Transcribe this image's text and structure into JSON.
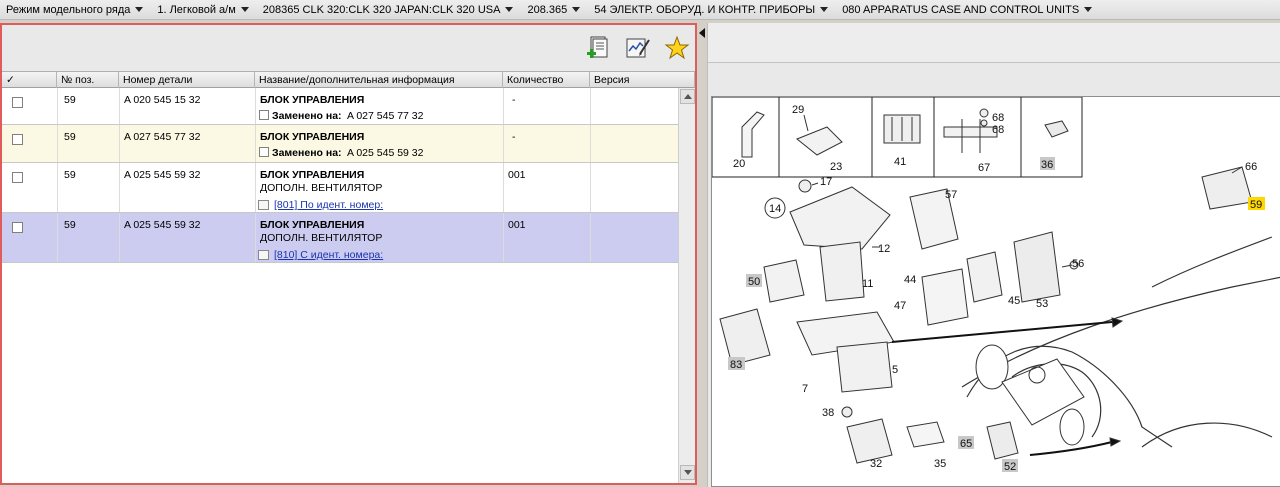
{
  "breadcrumbs": [
    {
      "label": "Режим модельного ряда"
    },
    {
      "label": "1. Легковой а/м"
    },
    {
      "label": "208365 CLK 320:CLK 320 JAPAN:CLK 320 USA"
    },
    {
      "label": "208.365"
    },
    {
      "label": "54 ЭЛЕКТР. ОБОРУД. И КОНТР. ПРИБОРЫ"
    },
    {
      "label": "080 APPARATUS CASE AND CONTROL UNITS"
    }
  ],
  "toolbar": {
    "icons": [
      "add-to-cart-icon",
      "notes-edit-icon",
      "favorite-star-icon"
    ]
  },
  "grid": {
    "columns": {
      "check": "✓",
      "pos": "№ поз.",
      "part": "Номер детали",
      "name": "Название/дополнительная информация",
      "qty": "Количество",
      "version": "Версия"
    },
    "rows": [
      {
        "pos": "59",
        "part": "A 020 545 15 32",
        "name": "БЛОК УПРАВЛЕНИЯ",
        "qty": "-",
        "replaced_label": "Заменено на:",
        "replaced_value": "A 027 545 77 32",
        "bg": "#ffffff"
      },
      {
        "pos": "59",
        "part": "A 027 545 77 32",
        "name": "БЛОК УПРАВЛЕНИЯ",
        "qty": "-",
        "replaced_label": "Заменено на:",
        "replaced_value": "A 025 545 59 32",
        "bg": "#fbf8e3"
      },
      {
        "pos": "59",
        "part": "A 025 545 59 32",
        "name": "БЛОК УПРАВЛЕНИЯ",
        "extra": "ДОПОЛН. ВЕНТИЛЯТОР",
        "qty": "001",
        "link": "[801] По идент. номер:",
        "bg": "#ffffff"
      },
      {
        "pos": "59",
        "part": "A 025 545 59 32",
        "name": "БЛОК УПРАВЛЕНИЯ",
        "extra": "ДОПОЛН. ВЕНТИЛЯТОР",
        "qty": "001",
        "link": "[810] С идент. номера:",
        "bg": "#ccccf0"
      }
    ]
  },
  "diagram": {
    "labels": {
      "l20": "20",
      "l29": "29",
      "l23": "23",
      "l41": "41",
      "l68a": "68",
      "l68b": "68",
      "l67": "67",
      "l36": "36",
      "l66": "66",
      "l59": "59",
      "l17": "17",
      "l14": "14",
      "l57": "57",
      "l12": "12",
      "l50": "50",
      "l44": "44",
      "l11": "11",
      "l56": "56",
      "l45": "45",
      "l53": "53",
      "l47": "47",
      "l83": "83",
      "l5": "5",
      "l7": "7",
      "l38": "38",
      "l65": "65",
      "l32": "32",
      "l35": "35",
      "l52": "52"
    }
  },
  "colors": {
    "accent_border": "#e05b5b",
    "selected_row": "#ccccf0",
    "highlight_row": "#fbf8e3",
    "link": "#1a33b0",
    "callout_highlight": "#ffd800"
  }
}
